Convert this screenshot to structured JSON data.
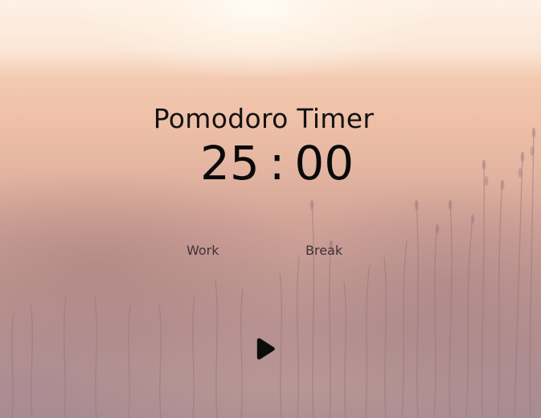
{
  "app": {
    "title": "Pomodoro Timer"
  },
  "timer": {
    "minutes": "25",
    "separator": ":",
    "seconds": "00"
  },
  "modes": {
    "work_label": "Work",
    "break_label": "Break"
  },
  "controls": {
    "play_icon": "play-icon"
  },
  "colors": {
    "title_text": "#121212",
    "timer_text": "#0a0a0a",
    "mode_text": "#3e3236"
  }
}
